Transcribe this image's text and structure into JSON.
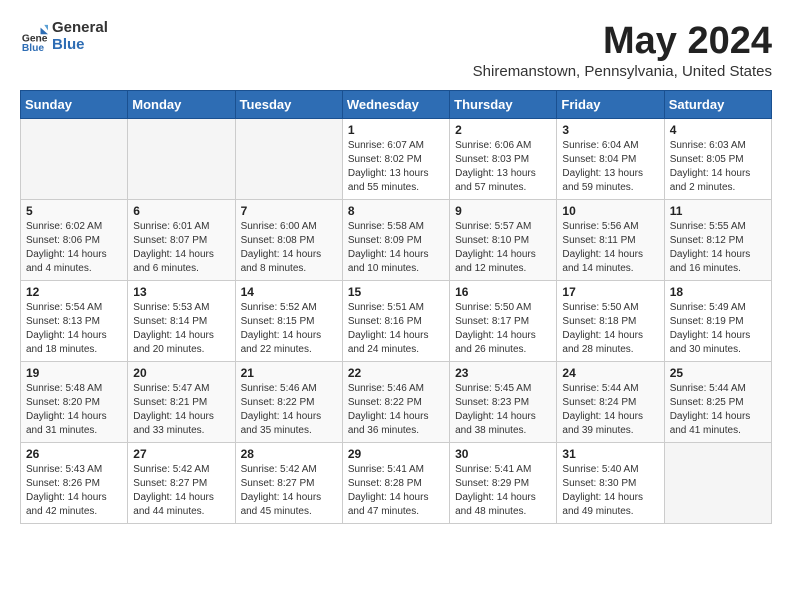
{
  "header": {
    "logo_general": "General",
    "logo_blue": "Blue",
    "title": "May 2024",
    "location": "Shiremanstown, Pennsylvania, United States"
  },
  "days_of_week": [
    "Sunday",
    "Monday",
    "Tuesday",
    "Wednesday",
    "Thursday",
    "Friday",
    "Saturday"
  ],
  "weeks": [
    [
      {
        "day": "",
        "info": ""
      },
      {
        "day": "",
        "info": ""
      },
      {
        "day": "",
        "info": ""
      },
      {
        "day": "1",
        "info": "Sunrise: 6:07 AM\nSunset: 8:02 PM\nDaylight: 13 hours\nand 55 minutes."
      },
      {
        "day": "2",
        "info": "Sunrise: 6:06 AM\nSunset: 8:03 PM\nDaylight: 13 hours\nand 57 minutes."
      },
      {
        "day": "3",
        "info": "Sunrise: 6:04 AM\nSunset: 8:04 PM\nDaylight: 13 hours\nand 59 minutes."
      },
      {
        "day": "4",
        "info": "Sunrise: 6:03 AM\nSunset: 8:05 PM\nDaylight: 14 hours\nand 2 minutes."
      }
    ],
    [
      {
        "day": "5",
        "info": "Sunrise: 6:02 AM\nSunset: 8:06 PM\nDaylight: 14 hours\nand 4 minutes."
      },
      {
        "day": "6",
        "info": "Sunrise: 6:01 AM\nSunset: 8:07 PM\nDaylight: 14 hours\nand 6 minutes."
      },
      {
        "day": "7",
        "info": "Sunrise: 6:00 AM\nSunset: 8:08 PM\nDaylight: 14 hours\nand 8 minutes."
      },
      {
        "day": "8",
        "info": "Sunrise: 5:58 AM\nSunset: 8:09 PM\nDaylight: 14 hours\nand 10 minutes."
      },
      {
        "day": "9",
        "info": "Sunrise: 5:57 AM\nSunset: 8:10 PM\nDaylight: 14 hours\nand 12 minutes."
      },
      {
        "day": "10",
        "info": "Sunrise: 5:56 AM\nSunset: 8:11 PM\nDaylight: 14 hours\nand 14 minutes."
      },
      {
        "day": "11",
        "info": "Sunrise: 5:55 AM\nSunset: 8:12 PM\nDaylight: 14 hours\nand 16 minutes."
      }
    ],
    [
      {
        "day": "12",
        "info": "Sunrise: 5:54 AM\nSunset: 8:13 PM\nDaylight: 14 hours\nand 18 minutes."
      },
      {
        "day": "13",
        "info": "Sunrise: 5:53 AM\nSunset: 8:14 PM\nDaylight: 14 hours\nand 20 minutes."
      },
      {
        "day": "14",
        "info": "Sunrise: 5:52 AM\nSunset: 8:15 PM\nDaylight: 14 hours\nand 22 minutes."
      },
      {
        "day": "15",
        "info": "Sunrise: 5:51 AM\nSunset: 8:16 PM\nDaylight: 14 hours\nand 24 minutes."
      },
      {
        "day": "16",
        "info": "Sunrise: 5:50 AM\nSunset: 8:17 PM\nDaylight: 14 hours\nand 26 minutes."
      },
      {
        "day": "17",
        "info": "Sunrise: 5:50 AM\nSunset: 8:18 PM\nDaylight: 14 hours\nand 28 minutes."
      },
      {
        "day": "18",
        "info": "Sunrise: 5:49 AM\nSunset: 8:19 PM\nDaylight: 14 hours\nand 30 minutes."
      }
    ],
    [
      {
        "day": "19",
        "info": "Sunrise: 5:48 AM\nSunset: 8:20 PM\nDaylight: 14 hours\nand 31 minutes."
      },
      {
        "day": "20",
        "info": "Sunrise: 5:47 AM\nSunset: 8:21 PM\nDaylight: 14 hours\nand 33 minutes."
      },
      {
        "day": "21",
        "info": "Sunrise: 5:46 AM\nSunset: 8:22 PM\nDaylight: 14 hours\nand 35 minutes."
      },
      {
        "day": "22",
        "info": "Sunrise: 5:46 AM\nSunset: 8:22 PM\nDaylight: 14 hours\nand 36 minutes."
      },
      {
        "day": "23",
        "info": "Sunrise: 5:45 AM\nSunset: 8:23 PM\nDaylight: 14 hours\nand 38 minutes."
      },
      {
        "day": "24",
        "info": "Sunrise: 5:44 AM\nSunset: 8:24 PM\nDaylight: 14 hours\nand 39 minutes."
      },
      {
        "day": "25",
        "info": "Sunrise: 5:44 AM\nSunset: 8:25 PM\nDaylight: 14 hours\nand 41 minutes."
      }
    ],
    [
      {
        "day": "26",
        "info": "Sunrise: 5:43 AM\nSunset: 8:26 PM\nDaylight: 14 hours\nand 42 minutes."
      },
      {
        "day": "27",
        "info": "Sunrise: 5:42 AM\nSunset: 8:27 PM\nDaylight: 14 hours\nand 44 minutes."
      },
      {
        "day": "28",
        "info": "Sunrise: 5:42 AM\nSunset: 8:27 PM\nDaylight: 14 hours\nand 45 minutes."
      },
      {
        "day": "29",
        "info": "Sunrise: 5:41 AM\nSunset: 8:28 PM\nDaylight: 14 hours\nand 47 minutes."
      },
      {
        "day": "30",
        "info": "Sunrise: 5:41 AM\nSunset: 8:29 PM\nDaylight: 14 hours\nand 48 minutes."
      },
      {
        "day": "31",
        "info": "Sunrise: 5:40 AM\nSunset: 8:30 PM\nDaylight: 14 hours\nand 49 minutes."
      },
      {
        "day": "",
        "info": ""
      }
    ]
  ]
}
